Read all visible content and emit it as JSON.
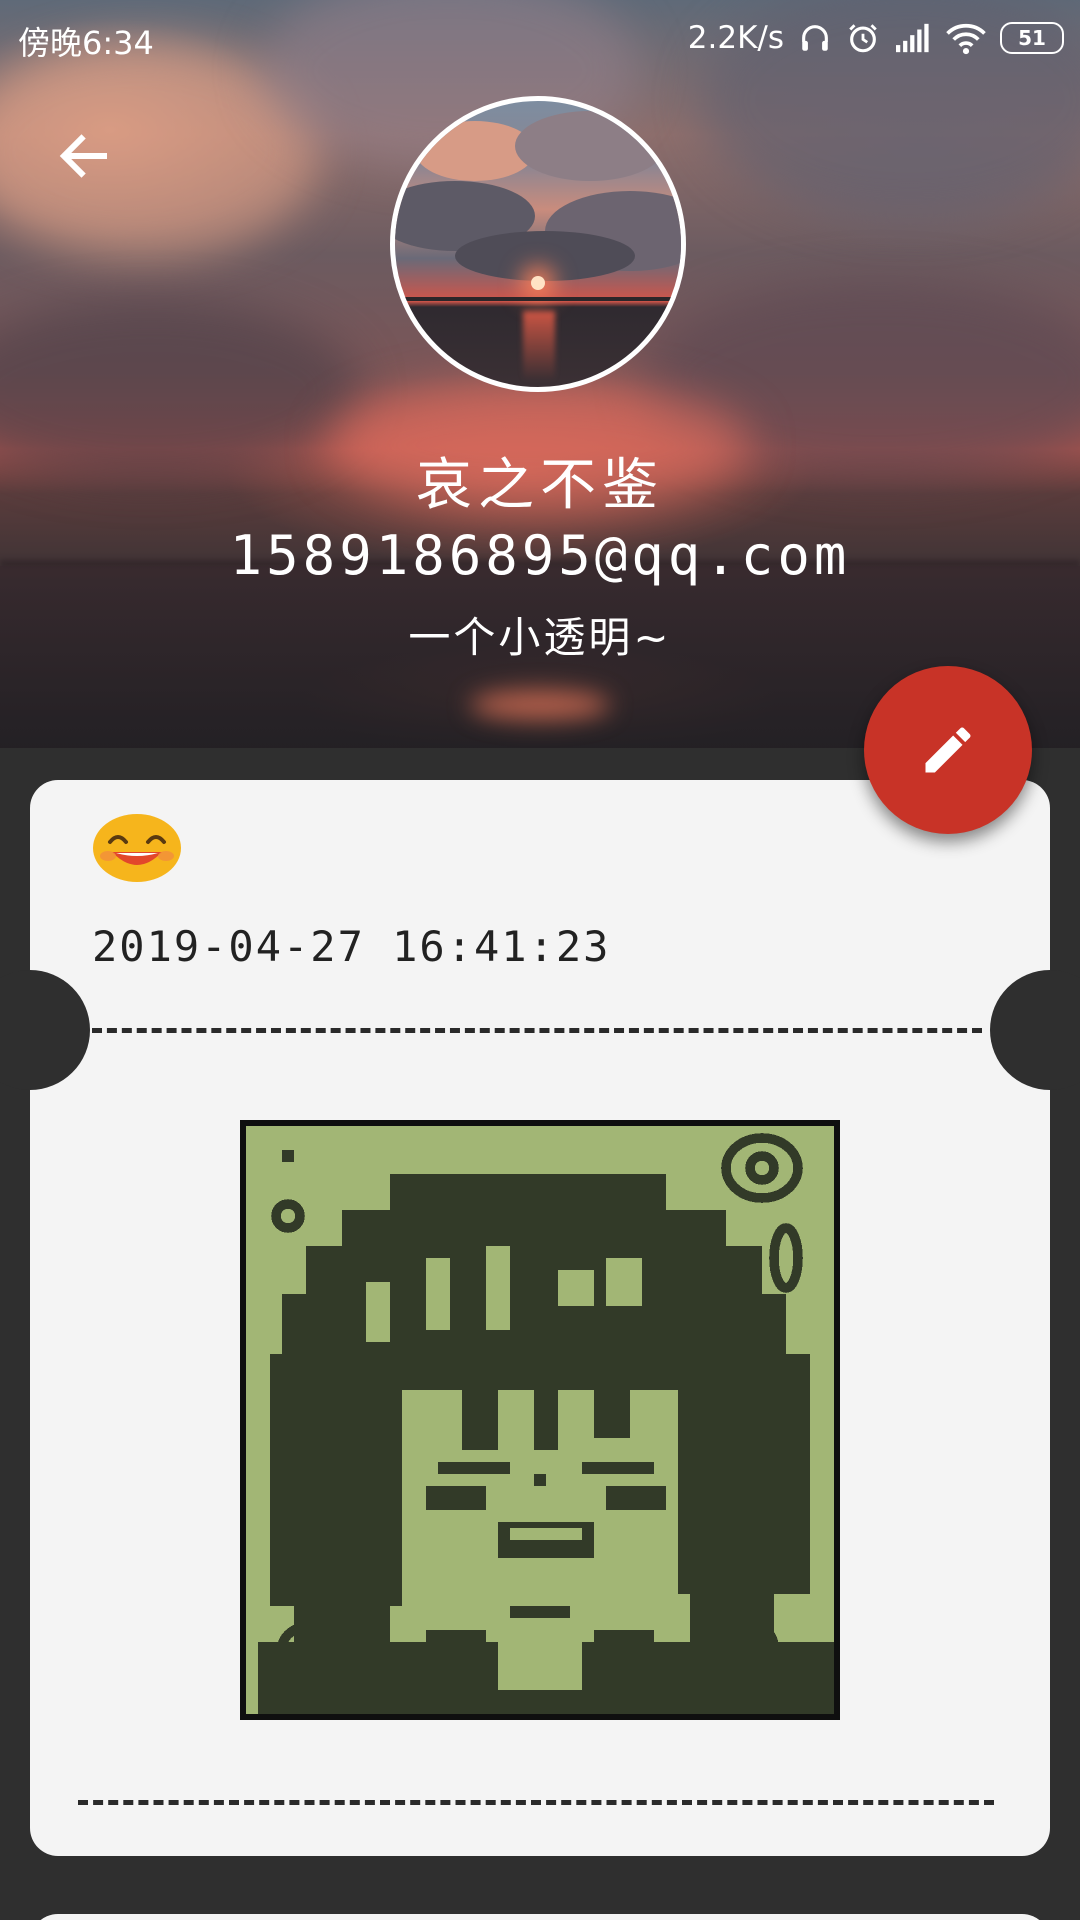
{
  "status_bar": {
    "time": "傍晚6:34",
    "net_speed": "2.2K/s",
    "battery": "51"
  },
  "profile": {
    "name": "哀之不鉴",
    "email": "1589186895@qq.com",
    "bio": "一个小透明~"
  },
  "entry": {
    "mood_icon": "smiling-face-emoji",
    "datetime": "2019-04-27 16:41:23",
    "image": "pixel-art-girl-green-portrait"
  },
  "icons": {
    "back": "arrow-left-icon",
    "edit": "pencil-icon"
  },
  "colors": {
    "fab": "#c83327",
    "card": "#f4f4f4",
    "background": "#2f2f2f",
    "pixel_light": "#a2b675",
    "pixel_dark": "#323a28"
  }
}
